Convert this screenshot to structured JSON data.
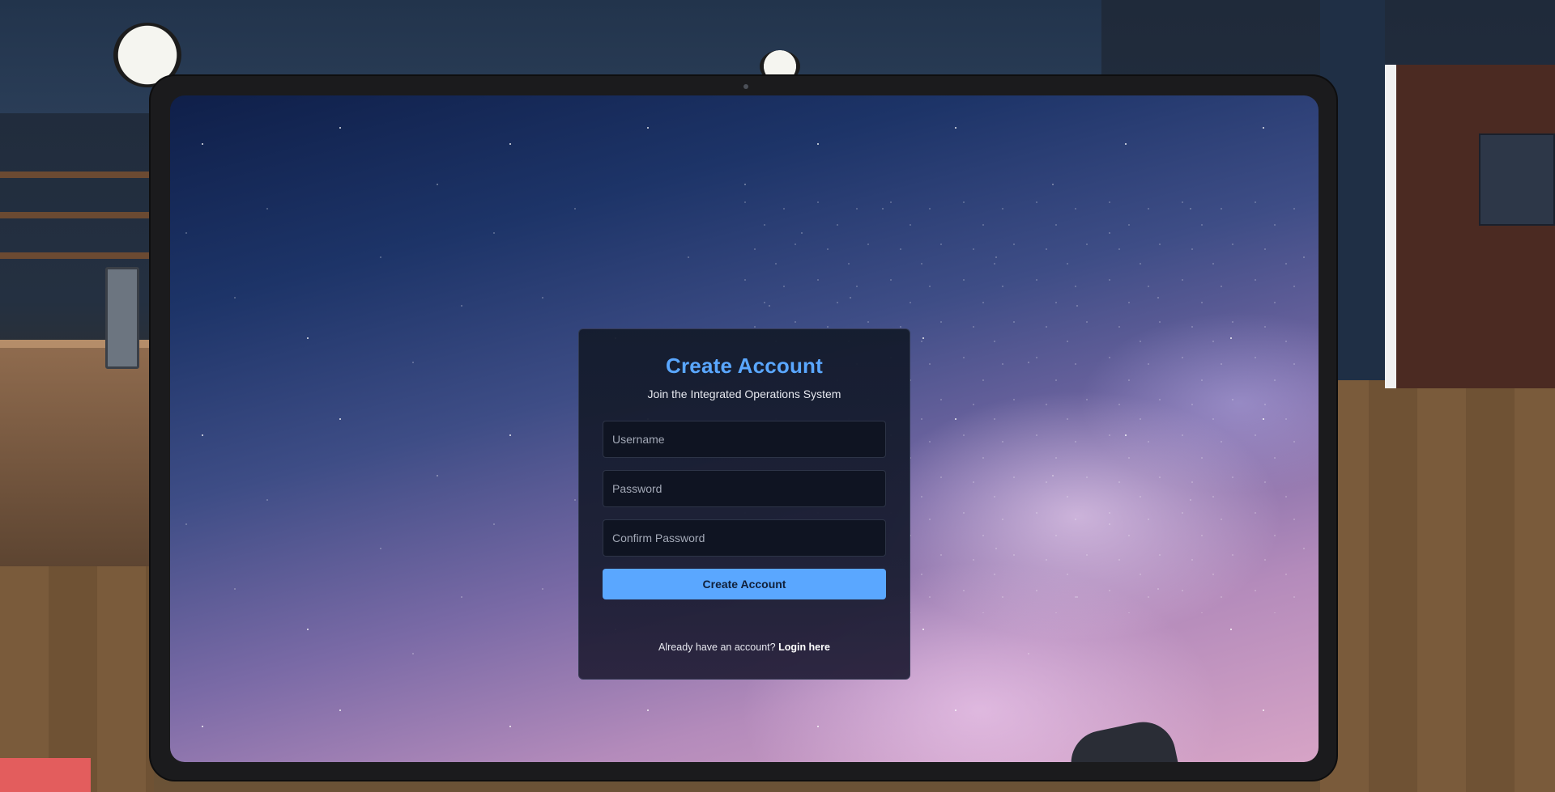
{
  "card": {
    "title": "Create Account",
    "subtitle": "Join the Integrated Operations System",
    "username_placeholder": "Username",
    "password_placeholder": "Password",
    "confirm_placeholder": "Confirm Password",
    "submit_label": "Create Account",
    "footer_prompt": "Already have an account?",
    "footer_link": "Login here"
  },
  "colors": {
    "accent": "#5aa7ff",
    "card_bg": "#141c2d",
    "field_bg": "#0f1422",
    "tablet_bezel": "#1b1b1d"
  },
  "icons": [
    "camera-dot",
    "wall-clock-icon"
  ]
}
